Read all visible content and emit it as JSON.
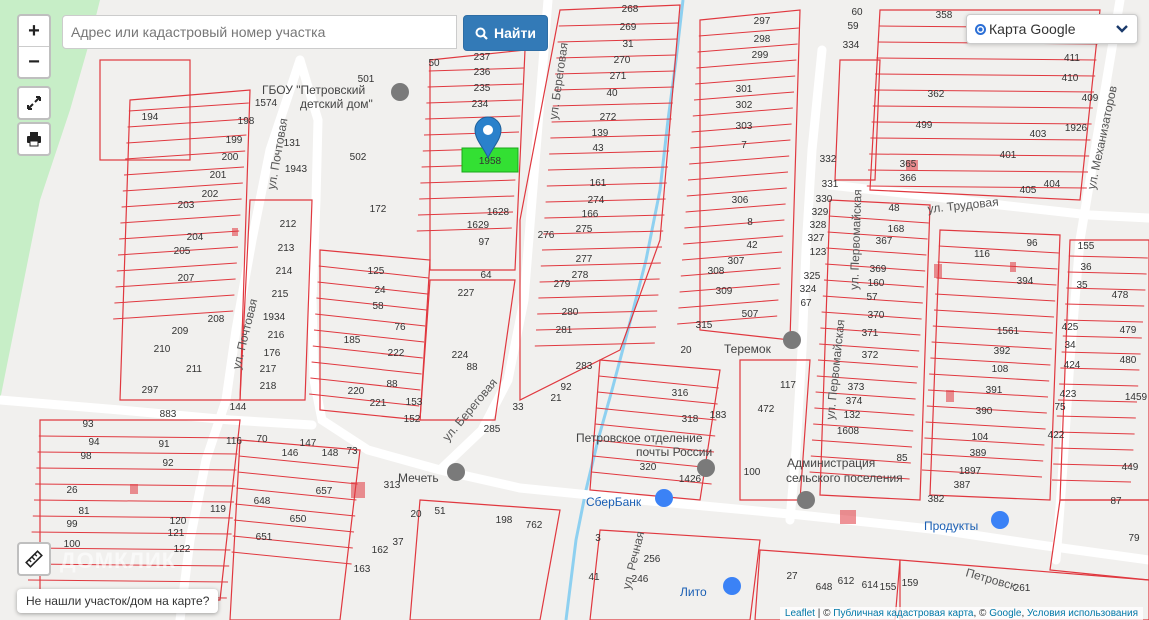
{
  "controls": {
    "zoom_in": "+",
    "zoom_out": "−",
    "fullscreen_icon": "expand-icon",
    "print_icon": "printer-icon",
    "ruler_icon": "ruler-icon"
  },
  "search": {
    "placeholder": "Адрес или кадастровый номер участка",
    "value": "",
    "button_label": "Найти",
    "button_icon": "search-icon"
  },
  "layer_switch": {
    "label": "Карта Google"
  },
  "not_found_button": "Не нашли участок/дом на карте?",
  "attribution": {
    "leaflet": "Leaflet",
    "sep1": " | © ",
    "cadastral": "Публичная кадастровая карта",
    "sep2": ", © ",
    "google": "Google",
    "sep3": ", ",
    "terms": "Условия использования"
  },
  "watermark": {
    "logo": "ДОМКЛИК"
  },
  "colors": {
    "parcel_line": "#e0383f",
    "selected_parcel": "#33e033",
    "marker": "#2a81cb",
    "button": "#337ab7",
    "green_area": "#c7eec7",
    "canal": "#8ed0f0"
  },
  "selected_parcel": "1958",
  "streets": [
    "ул. Береговая",
    "ул. Береговая",
    "ул. Почтовая",
    "ул. Почтовая",
    "ул. Первомайская",
    "ул. Первомайская",
    "ул. Трудовая",
    "ул. Механизаторов",
    "ул. Речная",
    "Петровск"
  ],
  "pois": [
    "ГБОУ \"Петровский",
    "детский дом\"",
    "Мечеть",
    "Петровское отделение",
    "почты России",
    "СберБанк",
    "Теремок",
    "Администрация",
    "сельского поселения",
    "Продукты",
    "Лито"
  ],
  "parcels": [
    "268",
    "269",
    "31",
    "270",
    "271",
    "40",
    "272",
    "139",
    "43",
    "161",
    "274",
    "166",
    "275",
    "277",
    "278",
    "279",
    "280",
    "281",
    "283",
    "92",
    "21",
    "276",
    "237",
    "236",
    "235",
    "234",
    "50",
    "501",
    "502",
    "172",
    "1628",
    "1629",
    "97",
    "64",
    "227",
    "125",
    "24",
    "58",
    "76",
    "185",
    "222",
    "220",
    "221",
    "88",
    "224",
    "88",
    "153",
    "152",
    "285",
    "33",
    "1574",
    "198",
    "199",
    "200",
    "201",
    "202",
    "203",
    "204",
    "205",
    "207",
    "208",
    "209",
    "210",
    "211",
    "297",
    "883",
    "91",
    "92",
    "93",
    "94",
    "98",
    "26",
    "81",
    "99",
    "100",
    "194",
    "131",
    "1943",
    "212",
    "213",
    "214",
    "215",
    "1934",
    "216",
    "176",
    "217",
    "218",
    "144",
    "116",
    "70",
    "146",
    "147",
    "148",
    "73",
    "657",
    "313",
    "648",
    "650",
    "651",
    "119",
    "120",
    "121",
    "122",
    "198",
    "762",
    "20",
    "51",
    "162",
    "163",
    "37",
    "306",
    "8",
    "42",
    "307",
    "308",
    "309",
    "315",
    "20",
    "507",
    "297",
    "298",
    "299",
    "301",
    "302",
    "303",
    "7",
    "316",
    "318",
    "320",
    "183",
    "100",
    "472",
    "117",
    "1426",
    "332",
    "331",
    "330",
    "329",
    "328",
    "327",
    "123",
    "325",
    "324",
    "67",
    "48",
    "168",
    "367",
    "369",
    "160",
    "57",
    "370",
    "371",
    "372",
    "373",
    "374",
    "132",
    "1608",
    "85",
    "60",
    "59",
    "334",
    "358",
    "362",
    "499",
    "365",
    "366",
    "116",
    "96",
    "394",
    "1561",
    "392",
    "108",
    "391",
    "390",
    "104",
    "389",
    "1897",
    "387",
    "382",
    "411",
    "410",
    "409",
    "1926",
    "401",
    "403",
    "405",
    "404",
    "155",
    "36",
    "35",
    "478",
    "425",
    "34",
    "424",
    "423",
    "75",
    "422",
    "479",
    "480",
    "1459",
    "449",
    "87",
    "79",
    "3",
    "41",
    "246",
    "256",
    "27",
    "648",
    "612",
    "614",
    "155",
    "159",
    "261"
  ]
}
